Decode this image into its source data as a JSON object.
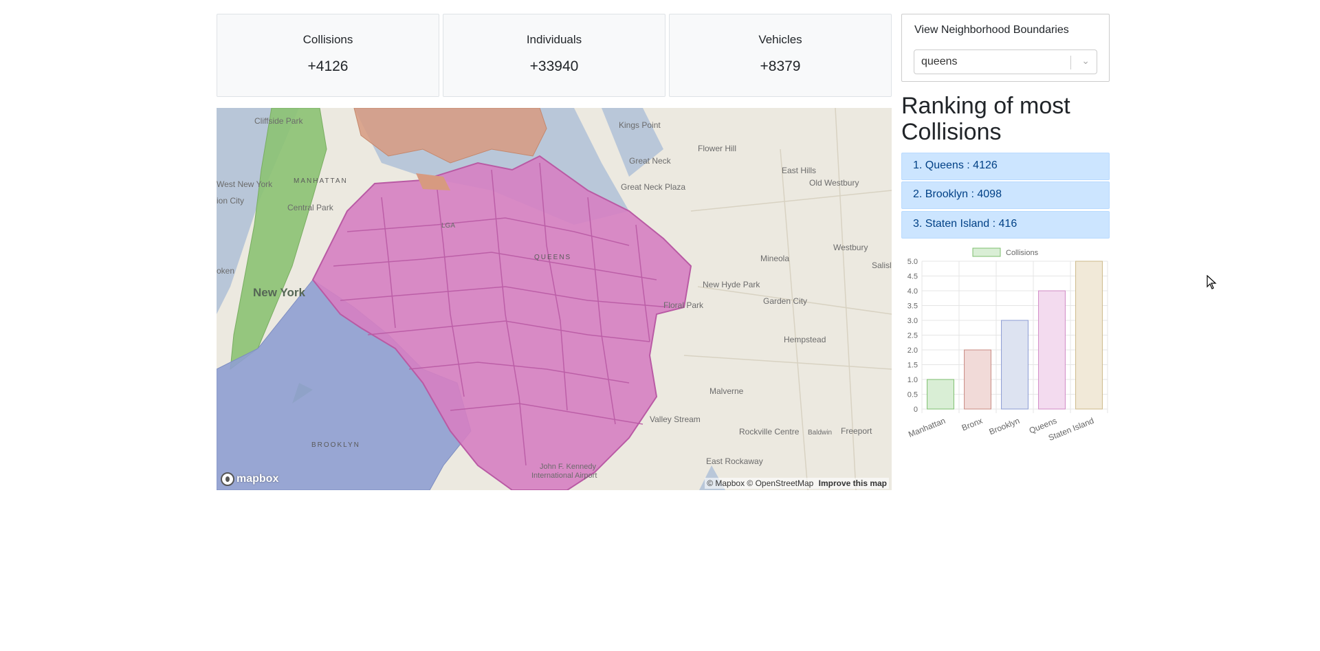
{
  "stats": [
    {
      "label": "Collisions",
      "value": "+4126"
    },
    {
      "label": "Individuals",
      "value": "+33940"
    },
    {
      "label": "Vehicles",
      "value": "+8379"
    }
  ],
  "map": {
    "labels": {
      "cliffside_park": "Cliffside Park",
      "kings_point": "Kings Point",
      "flower_hill": "Flower Hill",
      "great_neck": "Great Neck",
      "east_hills": "East Hills",
      "old_westbury": "Old Westbury",
      "manhattan": "MANHATTAN",
      "west_new_york": "West New York",
      "great_neck_plaza": "Great Neck Plaza",
      "union_city": "ion City",
      "central_park": "Central Park",
      "lga": "LGA",
      "queens": "QUEENS",
      "mineola": "Mineola",
      "westbury": "Westbury",
      "salis": "Salisl",
      "hoboken": "oken",
      "new_hyde_park": "New Hyde Park",
      "new_york": "New York",
      "floral_park": "Floral Park",
      "garden_city": "Garden City",
      "hempstead": "Hempstead",
      "malverne": "Malverne",
      "valley_stream": "Valley Stream",
      "rockville_centre": "Rockville Centre",
      "baldwin": "Baldwin",
      "freeport": "Freeport",
      "brooklyn": "BROOKLYN",
      "jfk": "John F. Kennedy",
      "jfk2": "International Airport",
      "east_rockaway": "East Rockaway"
    },
    "logo_text": "mapbox",
    "attribution": "© Mapbox © OpenStreetMap",
    "improve_link": "Improve this map"
  },
  "boundary": {
    "title": "View Neighborhood Boundaries",
    "selected": "queens"
  },
  "ranking": {
    "title": "Ranking of most Collisions",
    "items": [
      "1. Queens : 4126",
      "2. Brooklyn : 4098",
      "3. Staten Island : 416"
    ]
  },
  "chart_data": {
    "type": "bar",
    "categories": [
      "Manhattan",
      "Bronx",
      "Brooklyn",
      "Queens",
      "Staten Island"
    ],
    "series": [
      {
        "name": "Collisions",
        "values": [
          1,
          2,
          3,
          4,
          5
        ]
      }
    ],
    "ylim": [
      0,
      5
    ],
    "yticks": [
      "0",
      "0.5",
      "1.0",
      "1.5",
      "2.0",
      "2.5",
      "3.0",
      "3.5",
      "4.0",
      "4.5",
      "5.0"
    ],
    "legend_position": "top",
    "grid": true,
    "colors": {
      "fill": [
        "#d9eed5",
        "#f1dad8",
        "#dde3f1",
        "#f3dbef",
        "#f1e9d8"
      ],
      "stroke": [
        "#7dbf6e",
        "#c98982",
        "#8a9bd3",
        "#d18ac6",
        "#cdb98a"
      ]
    }
  }
}
